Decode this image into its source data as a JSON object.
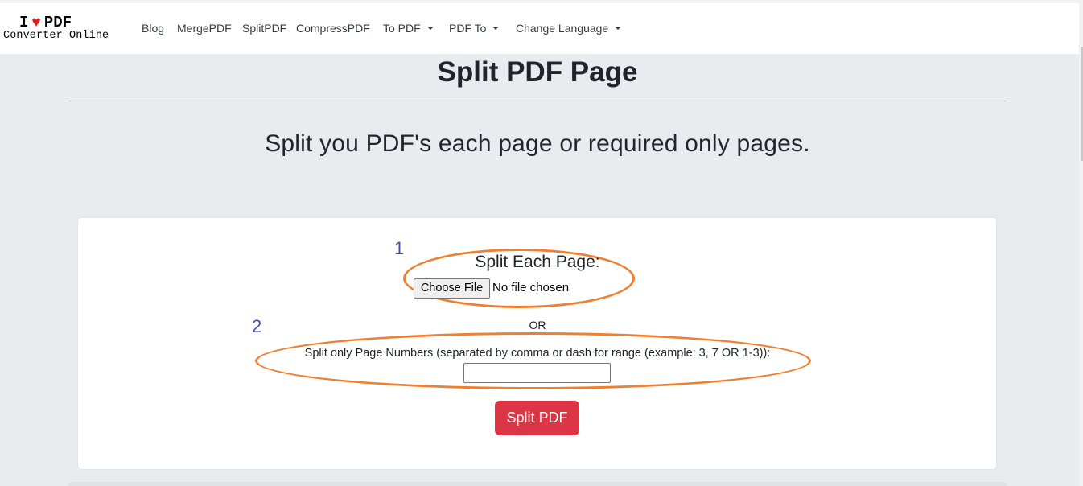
{
  "brand": {
    "top_left": "I",
    "top_right": "PDF",
    "subtitle": "Converter Online",
    "heart_icon": "heart-icon",
    "heart_color": "#e31b23"
  },
  "nav": {
    "blog": "Blog",
    "merge": "MergePDF",
    "split": "SplitPDF",
    "compress": "CompressPDF",
    "to_pdf": "To PDF",
    "pdf_to": "PDF To",
    "language": "Change Language"
  },
  "main": {
    "title": "Split PDF Page",
    "subtitle": "Split you PDF's each page or required only pages."
  },
  "form": {
    "annotation_1": "1",
    "annotation_2": "2",
    "each_page_label": "Split Each Page:",
    "choose_file": "Choose File",
    "no_file": "No file chosen",
    "or": "OR",
    "pages_label": "Split only Page Numbers (separated by comma or dash for range (example: 3, 7 OR 1-3)):",
    "pages_value": "",
    "submit": "Split PDF"
  },
  "colors": {
    "accent_danger": "#dc3545",
    "annotation_orange": "#f08030",
    "annotation_number": "#4a4fa8",
    "page_background": "#e9ecef"
  }
}
